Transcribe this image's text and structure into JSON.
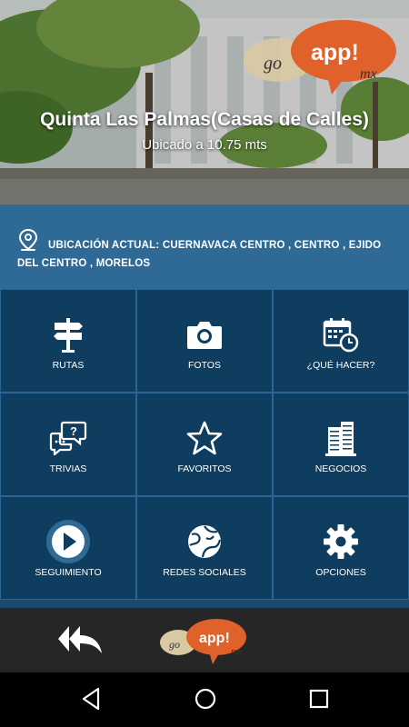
{
  "hero": {
    "title": "Quinta Las Palmas(Casas de Calles)",
    "distance": "Ubicado a 10.75 mts"
  },
  "brand": {
    "go": "go",
    "app": "app!",
    "mx": "mx"
  },
  "location": {
    "text": "UBICACIÓN ACTUAL: CUERNAVACA CENTRO , CENTRO , EJIDO DEL CENTRO , MORELOS"
  },
  "menu": [
    {
      "label": "RUTAS",
      "icon": "signpost-icon"
    },
    {
      "label": "FOTOS",
      "icon": "camera-icon"
    },
    {
      "label": "¿QUÉ HACER?",
      "icon": "calendar-clock-icon"
    },
    {
      "label": "TRIVIAS",
      "icon": "chat-question-icon"
    },
    {
      "label": "FAVORITOS",
      "icon": "star-icon"
    },
    {
      "label": "NEGOCIOS",
      "icon": "buildings-icon"
    },
    {
      "label": "SEGUIMIENTO",
      "icon": "play-circle-icon"
    },
    {
      "label": "REDES SOCIALES",
      "icon": "globe-icon"
    },
    {
      "label": "OPCIONES",
      "icon": "gear-icon"
    }
  ],
  "colors": {
    "tile": "#0f3d5f",
    "grid_gap": "#2a6594",
    "location_band": "#2f6a96",
    "brand_orange": "#e0622a"
  }
}
